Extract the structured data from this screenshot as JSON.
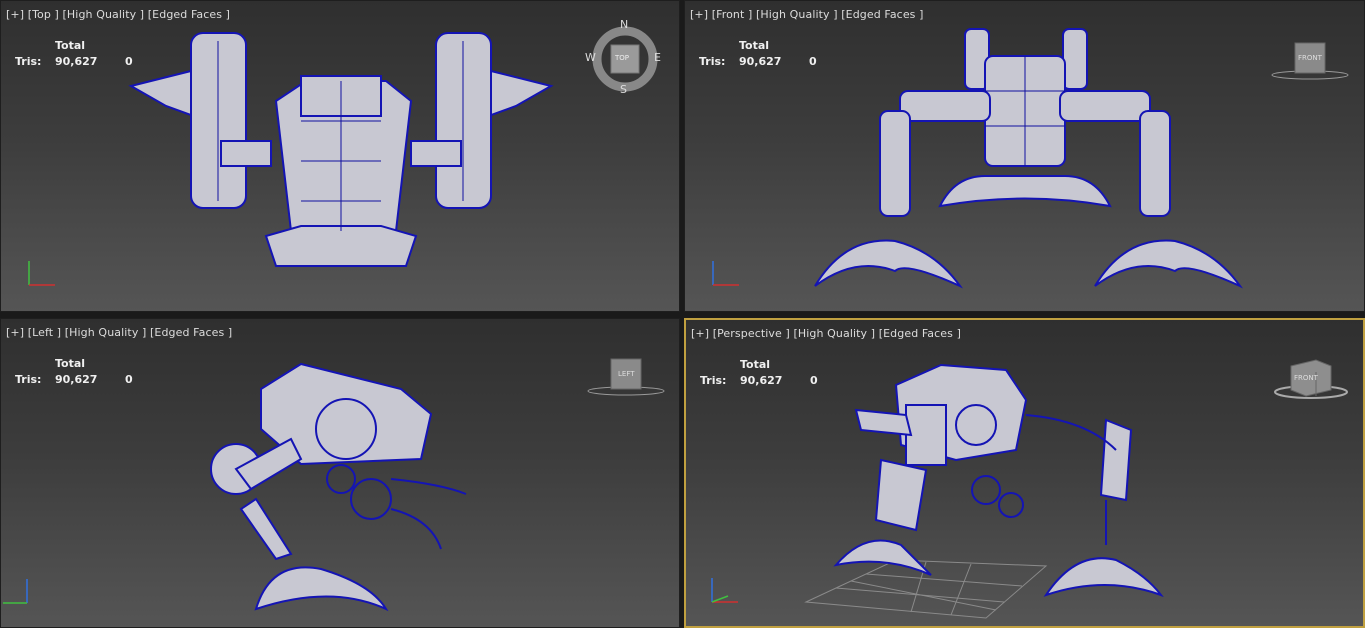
{
  "viewports": {
    "top": {
      "label": "[+] [Top ] [High Quality ] [Edged Faces ]",
      "cube": "TOP",
      "compass": {
        "n": "N",
        "s": "S",
        "e": "E",
        "w": "W"
      }
    },
    "front": {
      "label": "[+] [Front ] [High Quality ] [Edged Faces ]",
      "cube": "FRONT"
    },
    "left": {
      "label": "[+] [Left ] [High Quality ] [Edged Faces ]",
      "cube": "LEFT"
    },
    "perspective": {
      "label": "[+] [Perspective ] [High Quality ] [Edged Faces ]",
      "cube": "FRONT"
    }
  },
  "stats": {
    "header": "Total",
    "label": "Tris:",
    "total": "90,627",
    "selected": "0"
  },
  "colors": {
    "wire": "#1414b4",
    "mesh": "#c8c8d2",
    "active_border": "#c0a040"
  }
}
